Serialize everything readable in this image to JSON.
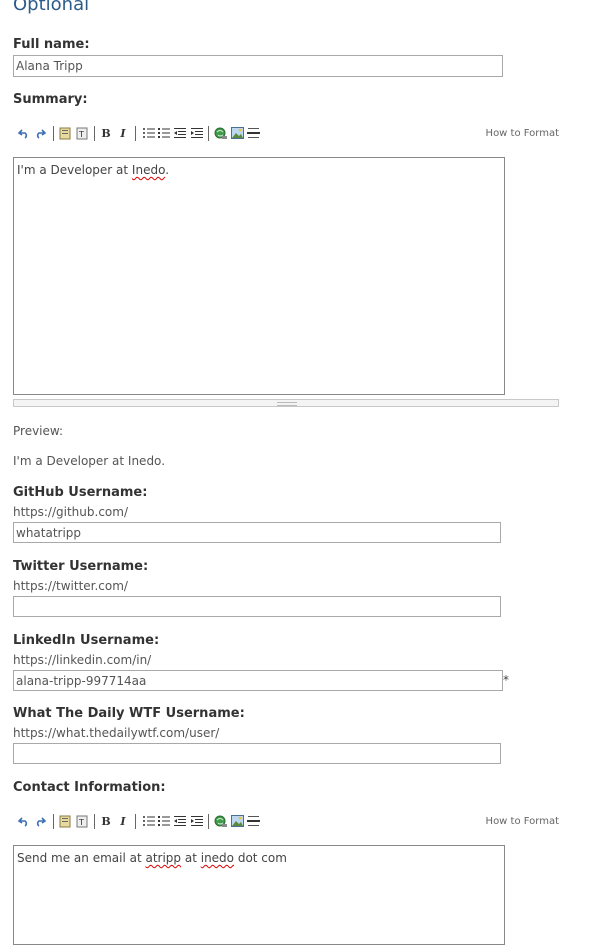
{
  "section": {
    "title": "Optional"
  },
  "full_name": {
    "label": "Full name:",
    "value": "Alana Tripp"
  },
  "summary": {
    "label": "Summary:",
    "howto": "How to Format",
    "text_before": "I'm a Developer at ",
    "text_misspelled": "Inedo",
    "text_after": ".",
    "preview_label": "Preview:",
    "preview_text": "I'm a Developer at Inedo."
  },
  "github": {
    "label": "GitHub Username:",
    "prefix": "https://github.com/",
    "value": "whatatripp"
  },
  "twitter": {
    "label": "Twitter Username:",
    "prefix": "https://twitter.com/",
    "value": ""
  },
  "linkedin": {
    "label": "LinkedIn Username:",
    "prefix": "https://linkedin.com/in/",
    "value": "alana-tripp-997714aa",
    "required_mark": "*"
  },
  "dailywtf": {
    "label": "What The Daily WTF Username:",
    "prefix": "https://what.thedailywtf.com/user/",
    "value": ""
  },
  "contact": {
    "label": "Contact Information:",
    "howto": "How to Format",
    "t1": "Send me an email at ",
    "w1": "atripp",
    "t2": " at ",
    "w2": "inedo",
    "t3": " dot com"
  },
  "toolbar_icons": [
    "undo-icon",
    "redo-icon",
    "paste-icon",
    "paste-text-icon",
    "bold-icon",
    "italic-icon",
    "bullet-list-icon",
    "numbered-list-icon",
    "outdent-icon",
    "indent-icon",
    "link-icon",
    "image-icon",
    "horizontal-rule-icon"
  ],
  "colors": {
    "heading": "#2c5c8c",
    "border": "#a9a9a9"
  }
}
